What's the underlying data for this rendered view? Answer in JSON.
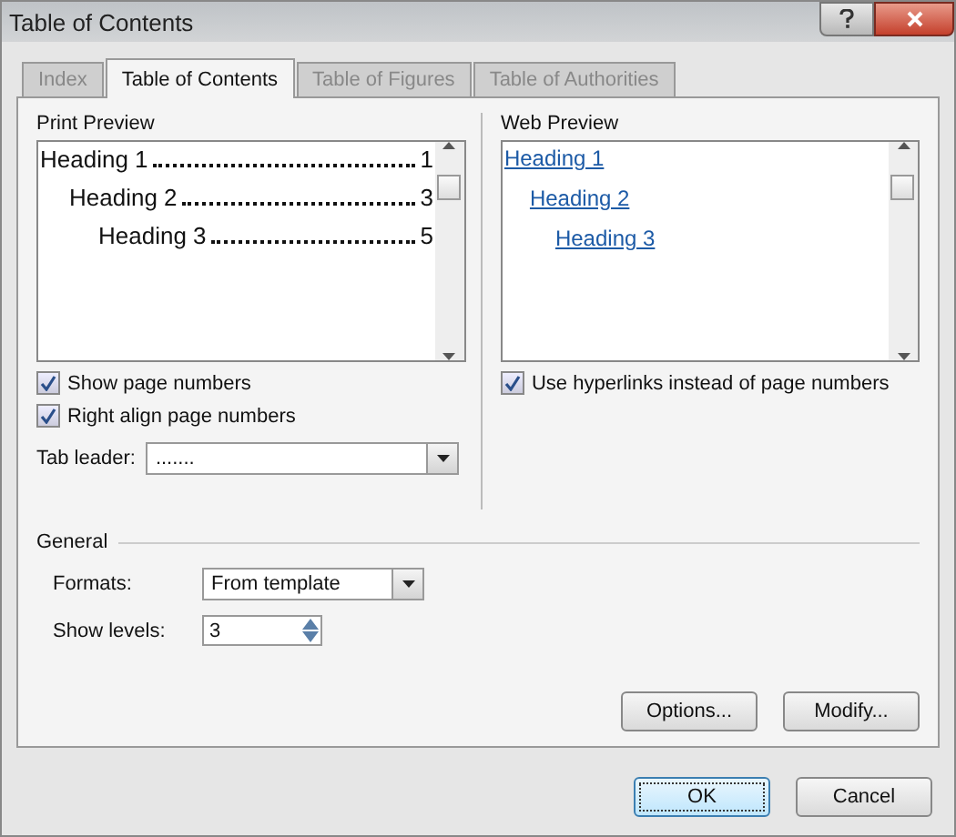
{
  "window": {
    "title": "Table of Contents"
  },
  "tabs": [
    {
      "label": "Index",
      "selected": false
    },
    {
      "label": "Table of Contents",
      "selected": true
    },
    {
      "label": "Table of Figures",
      "selected": false
    },
    {
      "label": "Table of Authorities",
      "selected": false
    }
  ],
  "print_preview": {
    "label": "Print Preview",
    "entries": [
      {
        "text": "Heading 1",
        "page": "1",
        "children": [
          {
            "text": "Heading 2",
            "page": "3",
            "children": [
              {
                "text": "Heading 3",
                "page": "5"
              }
            ]
          }
        ]
      }
    ],
    "options": [
      {
        "label": "Show page numbers",
        "checked": true
      },
      {
        "label": "Right align page numbers",
        "checked": true
      }
    ],
    "tab_leader": {
      "label": "Tab leader:",
      "value": "......."
    }
  },
  "web_preview": {
    "label": "Web Preview",
    "entries": [
      {
        "text": "Heading 1",
        "children": [
          {
            "text": "Heading 2",
            "children": [
              {
                "text": "Heading 3"
              }
            ]
          }
        ]
      }
    ],
    "options": [
      {
        "label": "Use hyperlinks instead of page numbers",
        "checked": true
      }
    ]
  },
  "general": {
    "label": "General",
    "formats": {
      "label": "Formats:",
      "value": "From template"
    },
    "show_levels": {
      "label": "Show levels:",
      "value": "3"
    }
  },
  "panel_buttons": [
    {
      "label": "Options...",
      "default": false
    },
    {
      "label": "Modify...",
      "default": false
    }
  ],
  "dialog_buttons": [
    {
      "label": "OK",
      "default": true
    },
    {
      "label": "Cancel",
      "default": false
    }
  ]
}
